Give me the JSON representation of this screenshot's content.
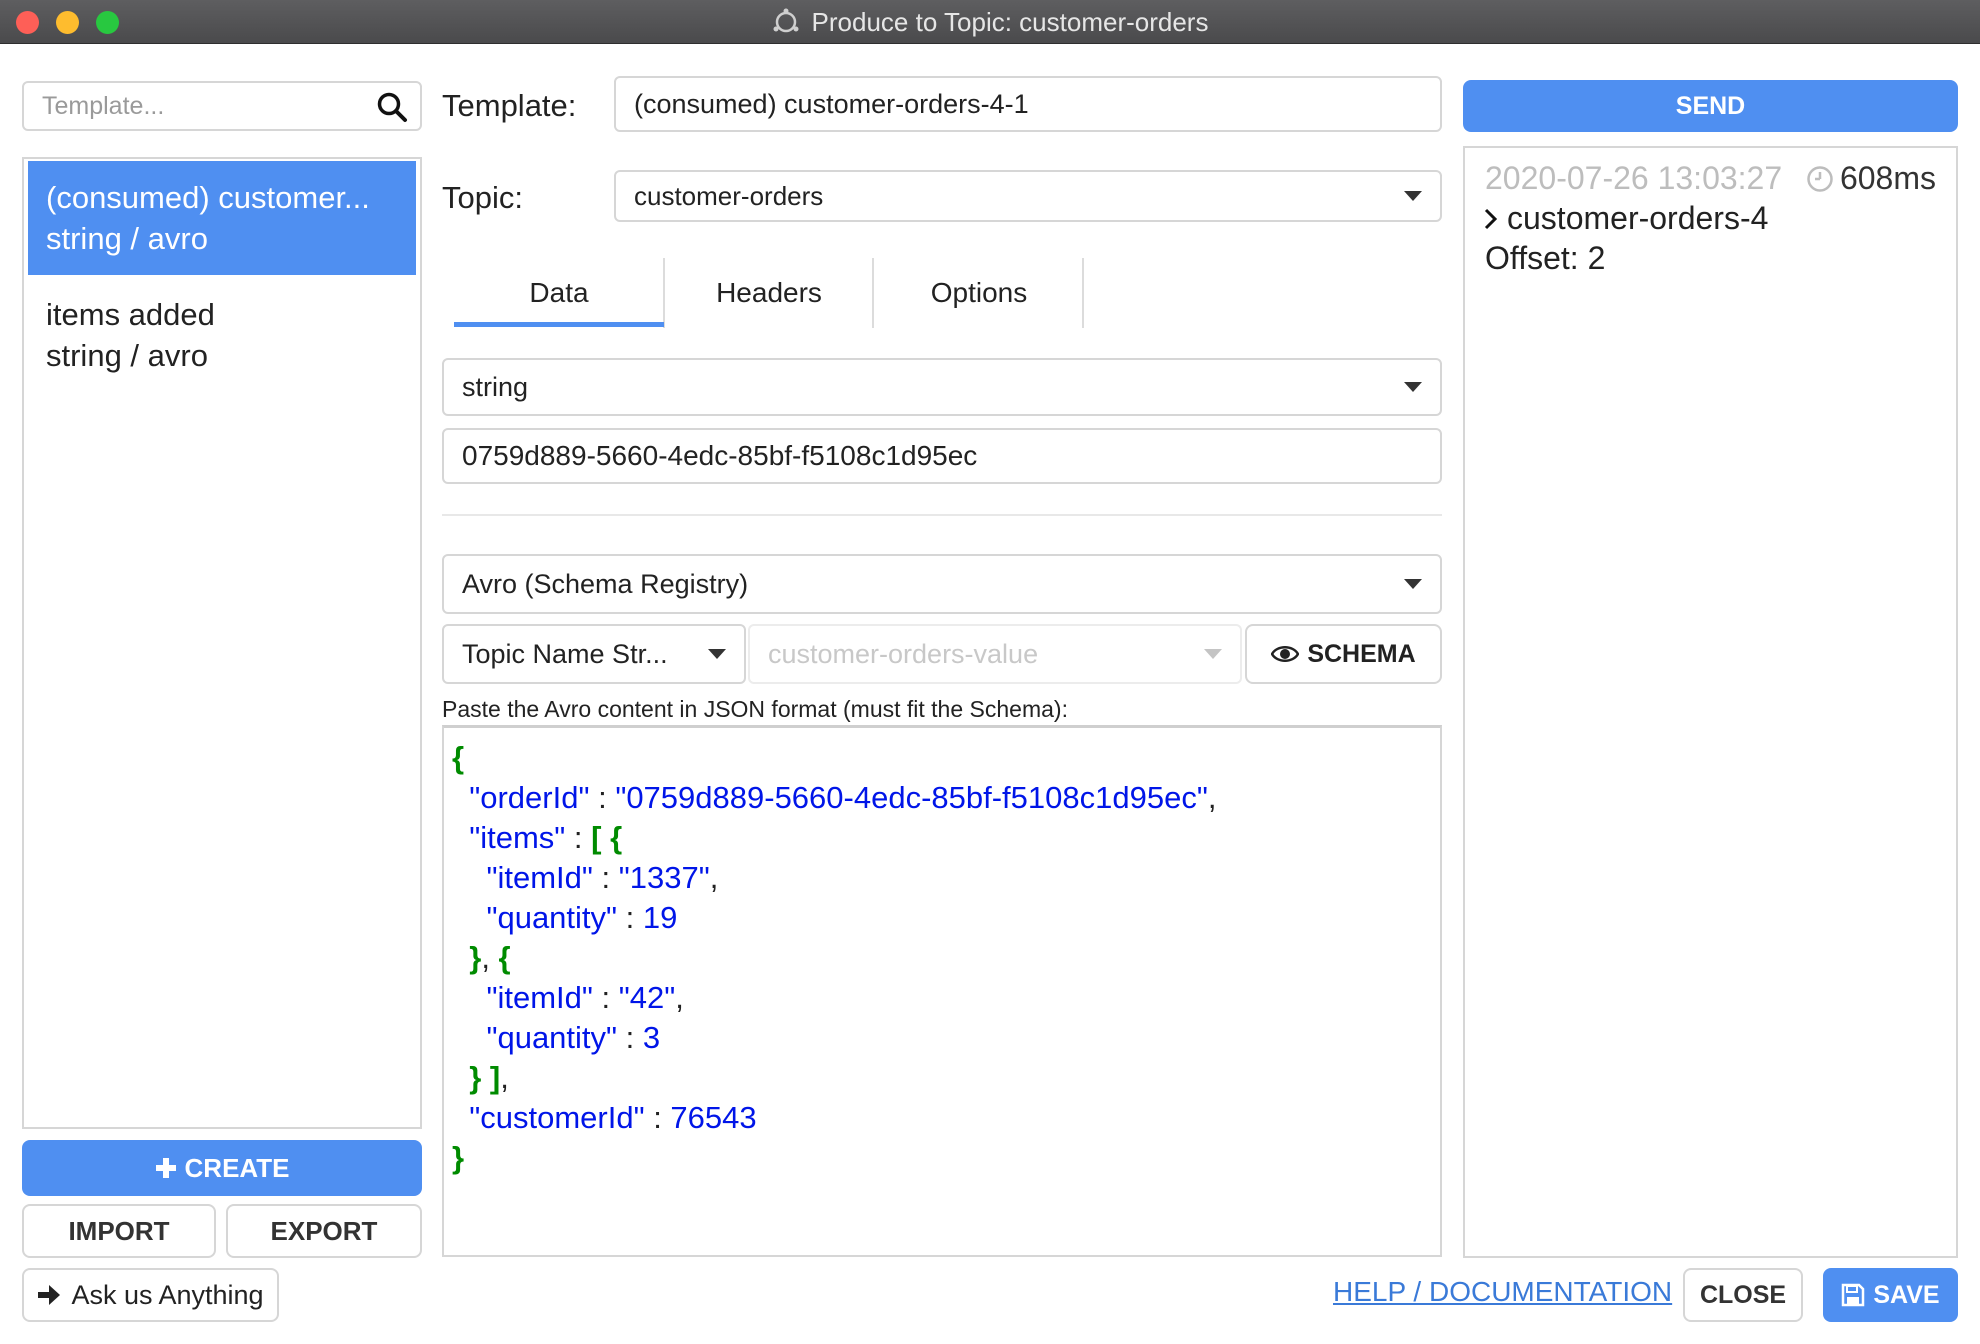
{
  "window": {
    "title": "Produce to Topic: customer-orders"
  },
  "sidebar": {
    "search_placeholder": "Template...",
    "templates": [
      {
        "name": "(consumed) customer...",
        "types": "string / avro",
        "selected": true
      },
      {
        "name": "items added",
        "types": "string / avro",
        "selected": false
      }
    ],
    "create_label": "CREATE",
    "import_label": "IMPORT",
    "export_label": "EXPORT",
    "ask_label": "Ask us Anything"
  },
  "form": {
    "template_label": "Template:",
    "template_value": "(consumed) customer-orders-4-1",
    "topic_label": "Topic:",
    "topic_value": "customer-orders",
    "tabs": [
      {
        "label": "Data",
        "active": true
      },
      {
        "label": "Headers",
        "active": false
      },
      {
        "label": "Options",
        "active": false
      }
    ],
    "key_type": "string",
    "key_value": "0759d889-5660-4edc-85bf-f5108c1d95ec",
    "value_type": "Avro (Schema Registry)",
    "subject_strategy": "Topic Name Str...",
    "subject_value": "customer-orders-value",
    "schema_label": "SCHEMA",
    "editor_hint": "Paste the Avro content in JSON format (must fit the Schema):",
    "json": {
      "orderId_key": "\"orderId\"",
      "orderId_val": "\"0759d889-5660-4edc-85bf-f5108c1d95ec\"",
      "items_key": "\"items\"",
      "itemId_key": "\"itemId\"",
      "quantity_key": "\"quantity\"",
      "item1_id": "\"1337\"",
      "item1_qty": "19",
      "item2_id": "\"42\"",
      "item2_qty": "3",
      "customerId_key": "\"customerId\"",
      "customerId_val": "76543"
    }
  },
  "result": {
    "send_label": "SEND",
    "timestamp": "2020-07-26 13:03:27",
    "duration": "608ms",
    "partition": "customer-orders-4",
    "offset": "Offset: 2"
  },
  "footer": {
    "help_label": "HELP / DOCUMENTATION",
    "close_label": "CLOSE",
    "save_label": "SAVE"
  },
  "colors": {
    "accent": "#4f8ff1",
    "json_key": "#0015e8",
    "json_bracket": "#008b00"
  }
}
